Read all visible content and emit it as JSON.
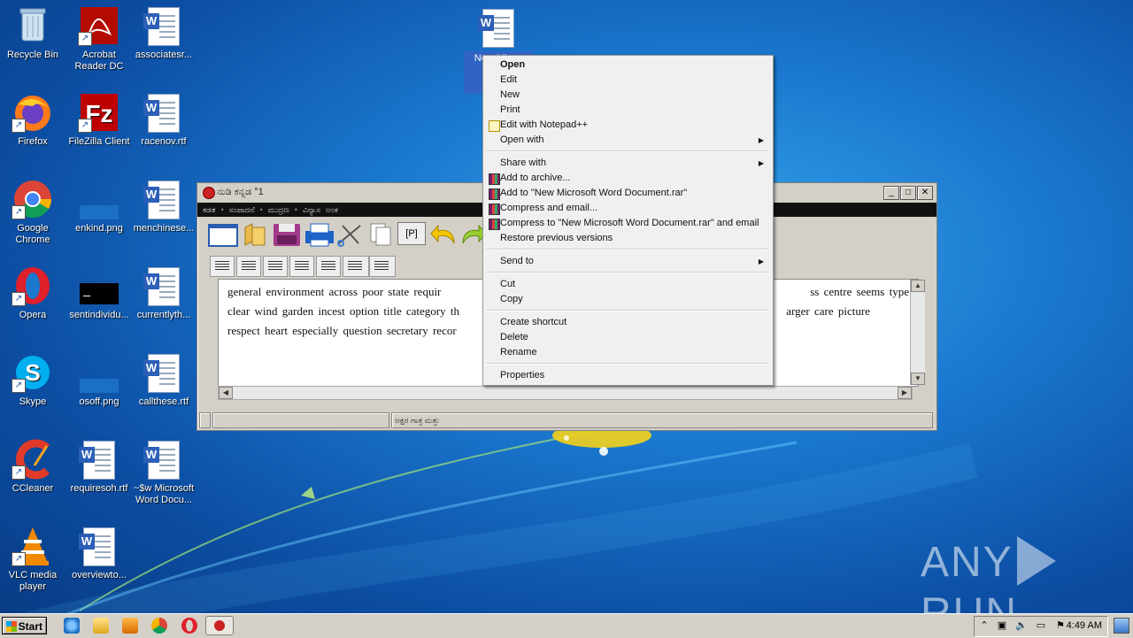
{
  "desktop_icons": [
    {
      "label": "Recycle Bin",
      "icon": "recycle-bin-icon"
    },
    {
      "label": "Acrobat Reader DC",
      "icon": "acrobat-icon"
    },
    {
      "label": "associatesr...",
      "icon": "word-document-icon"
    },
    {
      "label": "Firefox",
      "icon": "firefox-icon"
    },
    {
      "label": "FileZilla Client",
      "icon": "filezilla-icon"
    },
    {
      "label": "racenov.rtf",
      "icon": "word-document-icon"
    },
    {
      "label": "Google Chrome",
      "icon": "chrome-icon"
    },
    {
      "label": "enkind.png",
      "icon": "png-file-icon"
    },
    {
      "label": "menchinese...",
      "icon": "word-document-icon"
    },
    {
      "label": "Opera",
      "icon": "opera-icon"
    },
    {
      "label": "sentindividu...",
      "icon": "png-file-icon"
    },
    {
      "label": "currentlyth...",
      "icon": "word-document-icon"
    },
    {
      "label": "Skype",
      "icon": "skype-icon"
    },
    {
      "label": "osoff.png",
      "icon": "png-file-icon"
    },
    {
      "label": "callthese.rtf",
      "icon": "word-document-icon"
    },
    {
      "label": "CCleaner",
      "icon": "ccleaner-icon"
    },
    {
      "label": "requiresoh.rtf",
      "icon": "word-document-icon"
    },
    {
      "label": "~$w Microsoft Word Docu...",
      "icon": "word-document-icon"
    },
    {
      "label": "VLC media player",
      "icon": "vlc-icon"
    },
    {
      "label": "overviewto...",
      "icon": "word-document-icon"
    }
  ],
  "selected_icon": {
    "label": "New Microsoft Word Document",
    "label_line1": "New Micr...",
    "label_line2": "Doc..."
  },
  "editor": {
    "title": "ನುಡಿ ಕನ್ನಡ °1",
    "menus": [
      "ಕಡತ",
      "ಸಂಪಾದನೆ",
      "ಮುದ್ರಣ",
      "ವಿನ್ಯಾಸ",
      "ಅಂಕ"
    ],
    "toolbar_p_label": "[P]",
    "document_lines": [
      "general  environment  across poor  state  requir",
      "clear wind garden  incest option title category th",
      "respect heart especially question secretary recor"
    ],
    "document_lines_right": [
      "ss  centre seems  type",
      "arger care picture",
      ""
    ],
    "status_text": "ಅಕ್ಷರ ಗಾತ್ರ ಮತ್ತು"
  },
  "context_menu": {
    "items": [
      {
        "label": "Open",
        "bold": true
      },
      {
        "label": "Edit"
      },
      {
        "label": "New"
      },
      {
        "label": "Print"
      },
      {
        "label": "Edit with Notepad++",
        "icon": "notepadpp-icon"
      },
      {
        "label": "Open with",
        "submenu": true
      },
      {
        "label": "Share with",
        "submenu": true
      },
      {
        "label": "Add to archive...",
        "icon": "winrar-icon"
      },
      {
        "label": "Add to \"New Microsoft Word Document.rar\"",
        "icon": "winrar-icon"
      },
      {
        "label": "Compress and email...",
        "icon": "winrar-icon"
      },
      {
        "label": "Compress to \"New Microsoft Word Document.rar\" and email",
        "icon": "winrar-icon"
      },
      {
        "label": "Restore previous versions"
      },
      {
        "label": "Send to",
        "submenu": true
      },
      {
        "label": "Cut"
      },
      {
        "label": "Copy"
      },
      {
        "label": "Create shortcut"
      },
      {
        "label": "Delete"
      },
      {
        "label": "Rename"
      },
      {
        "label": "Properties"
      }
    ]
  },
  "taskbar": {
    "start_label": "Start",
    "pinned": [
      "ie-icon",
      "explorer-icon",
      "media-player-icon",
      "chrome-icon",
      "opera-icon",
      "nudi-icon"
    ],
    "clock": "4:49 AM"
  },
  "watermark": {
    "left": "ANY",
    "right": "RUN"
  }
}
